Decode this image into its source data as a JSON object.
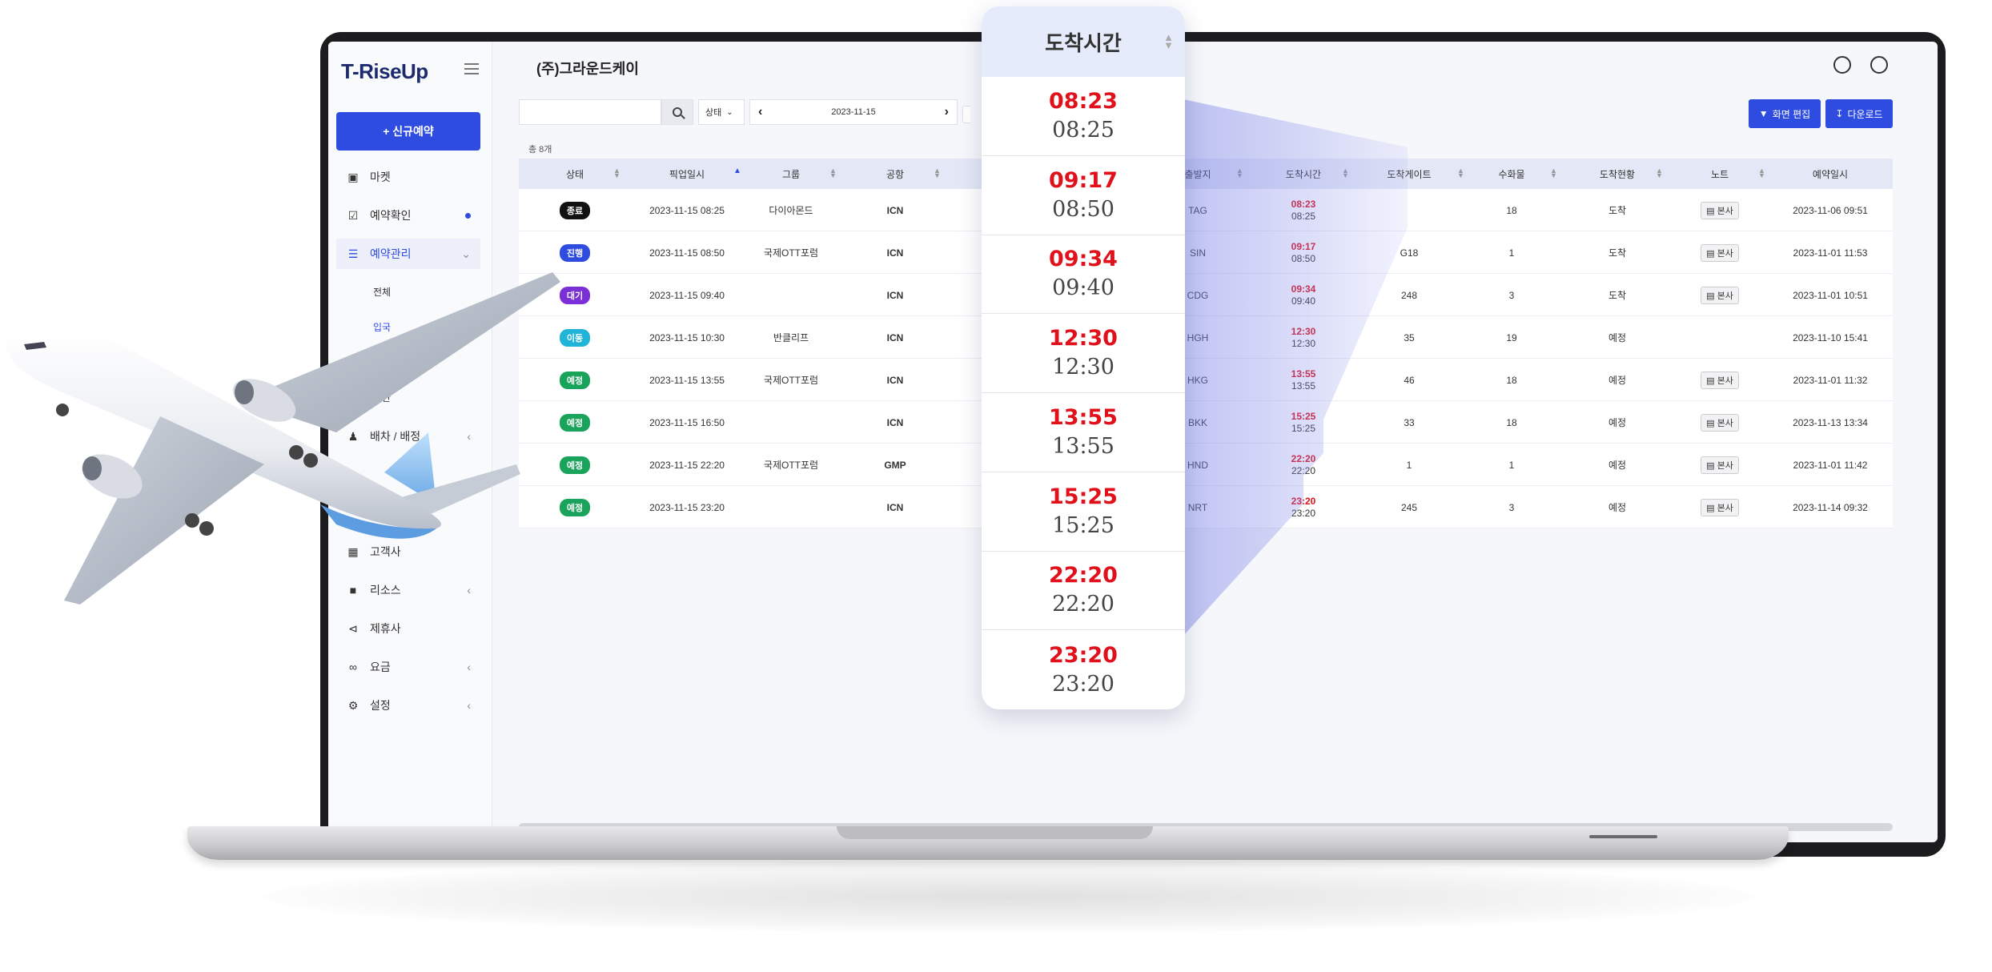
{
  "app": {
    "logo": "T-RiseUp",
    "company": "(주)그라운드케이"
  },
  "sidebar": {
    "new_button": "+ 신규예약",
    "items": [
      {
        "label": "마켓",
        "icon": "bag-icon"
      },
      {
        "label": "예약확인",
        "icon": "check-square-icon"
      },
      {
        "label": "예약관리",
        "icon": "list-icon"
      },
      {
        "label": "배차 / 배정",
        "icon": "user-plus-icon"
      },
      {
        "label": "고객사",
        "icon": "building-icon"
      },
      {
        "label": "리소스",
        "icon": "folder-icon"
      },
      {
        "label": "제휴사",
        "icon": "share-icon"
      },
      {
        "label": "요금",
        "icon": "link-icon"
      },
      {
        "label": "설정",
        "icon": "gears-icon"
      }
    ],
    "subitems": [
      "전체",
      "입국",
      "일반"
    ]
  },
  "toolbar": {
    "search_placeholder": "",
    "status_label": "상태",
    "date": "2023-11-15",
    "edit_label": "화면 편집",
    "download_label": "다운로드"
  },
  "table": {
    "total": "총 8개",
    "columns": [
      "상태",
      "픽업일시",
      "그룹",
      "공항",
      "출발지",
      "도착시간",
      "도착게이트",
      "수화물",
      "도착현황",
      "노트",
      "예약일시"
    ],
    "rows": [
      {
        "status": "종료",
        "status_color": "#111111",
        "pickup": "2023-11-15 08:25",
        "group": "다이아몬드",
        "airport": "ICN",
        "origin": "TAG",
        "sched": "08:23",
        "actual": "08:25",
        "gate": "",
        "bags": "18",
        "arrival": "도착",
        "note": "본사",
        "reserved": "2023-11-06 09:51"
      },
      {
        "status": "진행",
        "status_color": "#2e4de0",
        "pickup": "2023-11-15 08:50",
        "group": "국제OTT포럼",
        "airport": "ICN",
        "origin": "SIN",
        "sched": "09:17",
        "actual": "08:50",
        "gate": "G18",
        "bags": "1",
        "arrival": "도착",
        "note": "본사",
        "reserved": "2023-11-01 11:53"
      },
      {
        "status": "대기",
        "status_color": "#7b2fd6",
        "pickup": "2023-11-15 09:40",
        "group": "",
        "airport": "ICN",
        "origin": "CDG",
        "sched": "09:34",
        "actual": "09:40",
        "gate": "248",
        "bags": "3",
        "arrival": "도착",
        "note": "본사",
        "reserved": "2023-11-01 10:51"
      },
      {
        "status": "이동",
        "status_color": "#1fb4d8",
        "pickup": "2023-11-15 10:30",
        "group": "반클리프",
        "airport": "ICN",
        "origin": "HGH",
        "sched": "12:30",
        "actual": "12:30",
        "gate": "35",
        "bags": "19",
        "arrival": "예정",
        "note": "",
        "reserved": "2023-11-10 15:41"
      },
      {
        "status": "예정",
        "status_color": "#1aa35a",
        "pickup": "2023-11-15 13:55",
        "group": "국제OTT포럼",
        "airport": "ICN",
        "origin": "HKG",
        "sched": "13:55",
        "actual": "13:55",
        "gate": "46",
        "bags": "18",
        "arrival": "예정",
        "note": "본사",
        "reserved": "2023-11-01 11:32"
      },
      {
        "status": "예정",
        "status_color": "#1aa35a",
        "pickup": "2023-11-15 16:50",
        "group": "",
        "airport": "ICN",
        "origin": "BKK",
        "sched": "15:25",
        "actual": "15:25",
        "gate": "33",
        "bags": "18",
        "arrival": "예정",
        "note": "본사",
        "reserved": "2023-11-13 13:34"
      },
      {
        "status": "예정",
        "status_color": "#1aa35a",
        "pickup": "2023-11-15 22:20",
        "group": "국제OTT포럼",
        "airport": "GMP",
        "origin": "HND",
        "sched": "22:20",
        "actual": "22:20",
        "gate": "1",
        "bags": "1",
        "arrival": "예정",
        "note": "본사",
        "reserved": "2023-11-01 11:42"
      },
      {
        "status": "예정",
        "status_color": "#1aa35a",
        "pickup": "2023-11-15 23:20",
        "group": "",
        "airport": "ICN",
        "origin": "NRT",
        "sched": "23:20",
        "actual": "23:20",
        "gate": "245",
        "bags": "3",
        "arrival": "예정",
        "note": "본사",
        "reserved": "2023-11-14 09:32"
      }
    ]
  },
  "popup": {
    "header": "도착시간",
    "times": [
      {
        "sched": "08:23",
        "actual": "08:25"
      },
      {
        "sched": "09:17",
        "actual": "08:50"
      },
      {
        "sched": "09:34",
        "actual": "09:40"
      },
      {
        "sched": "12:30",
        "actual": "12:30"
      },
      {
        "sched": "13:55",
        "actual": "13:55"
      },
      {
        "sched": "15:25",
        "actual": "15:25"
      },
      {
        "sched": "22:20",
        "actual": "22:20"
      },
      {
        "sched": "23:20",
        "actual": "23:20"
      }
    ]
  },
  "colors": {
    "accent": "#2e4de0",
    "header_bg": "#e4e8f6",
    "late_red": "#e0111b"
  }
}
